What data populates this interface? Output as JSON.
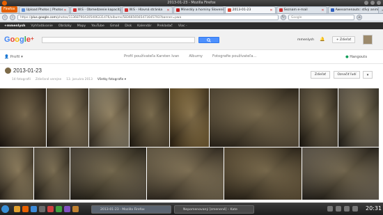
{
  "window": {
    "title": "2013-01-23 - Mozilla Firefox"
  },
  "browser": {
    "menu_label": "Firefox",
    "tabs": [
      {
        "label": "Upload Photos | Photos",
        "color": "#5d8fd8",
        "active": false
      },
      {
        "label": "W.S - Obmedzenie kapacity vyhľadávy",
        "color": "#d03030",
        "active": false
      },
      {
        "label": "W.S - Hlavná stránka",
        "color": "#d03030",
        "active": false
      },
      {
        "label": "Minerály a horniny Slovenska",
        "color": "#c02020",
        "active": false
      },
      {
        "label": "2013-01-23",
        "color": "#dd4b39",
        "active": true
      },
      {
        "label": "Seznam e-mail",
        "color": "#d03030",
        "active": false
      },
      {
        "label": "Awesomenauts: stĺvý animák - Re",
        "color": "#3060c0",
        "active": false
      }
    ],
    "url_prefix": "https://",
    "url_domain": "plus.google.com",
    "url_path": "/photos/113687904305406331476/albums/5836656565471645793?banner=pwa",
    "search_placeholder": "Google"
  },
  "gbar": {
    "items": [
      "+mmenlysh",
      "Vyhľadávanie",
      "Obrázky",
      "Mapy",
      "YouTube",
      "Gmail",
      "Disk",
      "Kalendár",
      "Prekladač",
      "Viac -"
    ]
  },
  "header": {
    "logo_text": "Google",
    "logo_plus": "+",
    "search_button_icon": "search-icon",
    "username": "mmenlysh",
    "share_label": "+ Zdieľať"
  },
  "subnav": {
    "profile_label": "Profil",
    "links": [
      "Profil používateľa Karsten Ivan",
      "Albumy",
      "Fotografie používateľa..."
    ],
    "hangouts_label": "Hangouts"
  },
  "album": {
    "title": "2013-01-23",
    "photo_count": "14 fotografií",
    "shared": "Zdieľané verejne",
    "date": "13. januára 2013",
    "view_label": "Všetky fotografie",
    "share_button": "Zdieľať",
    "share_more_button": "Označiť ľudí",
    "more_button": "▾"
  },
  "photos": [
    {
      "name": "cave-photo-1",
      "c1": "#5a4a34",
      "c2": "#2a2018"
    },
    {
      "name": "cave-photo-2",
      "c1": "#8a7a60",
      "c2": "#3a3024"
    },
    {
      "name": "cave-photo-3",
      "c1": "#b0a58c",
      "c2": "#4a4032"
    },
    {
      "name": "cave-photo-4",
      "c1": "#6b5a40",
      "c2": "#2c2418"
    },
    {
      "name": "cave-photo-5",
      "c1": "#9a7a40",
      "c2": "#3a2a14"
    },
    {
      "name": "cave-photo-6",
      "c1": "#7a6a50",
      "c2": "#2a2218"
    },
    {
      "name": "cave-photo-7",
      "c1": "#6a5e4a",
      "c2": "#221c14"
    },
    {
      "name": "cave-photo-8",
      "c1": "#8a8070",
      "c2": "#2e2a22"
    },
    {
      "name": "cave-photo-9",
      "c1": "#a09070",
      "c2": "#3c3226"
    },
    {
      "name": "cave-photo-10",
      "c1": "#807460",
      "c2": "#2a241c"
    },
    {
      "name": "cave-photo-11",
      "c1": "#6e6456",
      "c2": "#242018"
    },
    {
      "name": "cave-photo-12",
      "c1": "#9a8a6c",
      "c2": "#302820"
    },
    {
      "name": "cave-photo-13",
      "c1": "#7e6a4a",
      "c2": "#261e14"
    },
    {
      "name": "cave-photo-14",
      "c1": "#8c8274",
      "c2": "#1e1a16"
    }
  ],
  "taskbar": {
    "tasks": [
      {
        "label": "2013-01-23 - Mozilla Firefox",
        "active": true
      },
      {
        "label": "Nepomenovaný [zmenené] – Kate",
        "active": false
      }
    ],
    "clock": "20:31"
  }
}
